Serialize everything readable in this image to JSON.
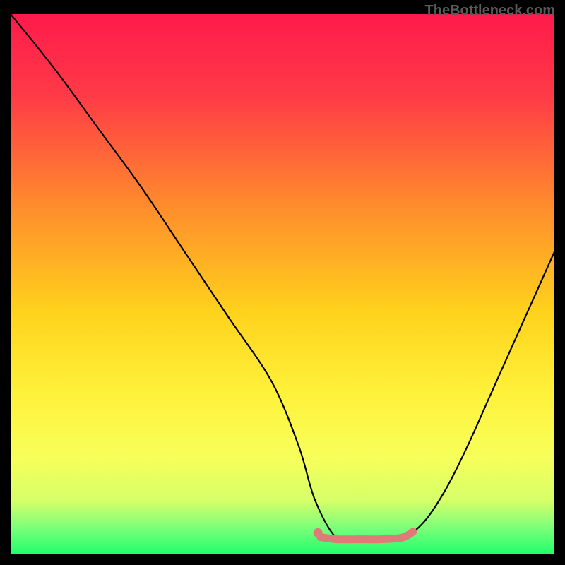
{
  "watermark": "TheBottleneck.com",
  "colors": {
    "bg_black": "#000000",
    "curve": "#000000",
    "highlight": "#e07a78",
    "highlight_dot": "#e07a78",
    "watermark": "#5a5a5a"
  },
  "chart_data": {
    "type": "line",
    "title": "",
    "xlabel": "",
    "ylabel": "",
    "xlim": [
      0,
      100
    ],
    "ylim": [
      0,
      100
    ],
    "grid": false,
    "legend": false,
    "annotations": [],
    "gradient_stops": [
      {
        "offset": 0.0,
        "color": "#ff1a4b"
      },
      {
        "offset": 0.15,
        "color": "#ff3a47"
      },
      {
        "offset": 0.35,
        "color": "#ff8a2d"
      },
      {
        "offset": 0.55,
        "color": "#ffd21c"
      },
      {
        "offset": 0.7,
        "color": "#fff13a"
      },
      {
        "offset": 0.82,
        "color": "#f7ff5a"
      },
      {
        "offset": 0.9,
        "color": "#d6ff68"
      },
      {
        "offset": 0.95,
        "color": "#7dff7a"
      },
      {
        "offset": 1.0,
        "color": "#1fff6b"
      }
    ],
    "series": [
      {
        "name": "bottleneck-curve",
        "x": [
          0,
          8,
          16,
          24,
          32,
          40,
          48,
          53,
          56,
          60,
          64,
          68,
          72,
          76,
          80,
          84,
          88,
          92,
          96,
          100
        ],
        "y": [
          100,
          90,
          79,
          68,
          56,
          44,
          32,
          20,
          10,
          3,
          3,
          3,
          3,
          6,
          12,
          20,
          29,
          38,
          47,
          56
        ]
      }
    ],
    "highlight_segment": {
      "comment": "salmon flat section near the bottom",
      "start_dot": {
        "x": 56.5,
        "y": 4.0
      },
      "x": [
        57,
        60,
        64,
        68,
        72,
        74
      ],
      "y": [
        3.2,
        2.8,
        2.8,
        2.8,
        3.1,
        4.2
      ]
    }
  }
}
